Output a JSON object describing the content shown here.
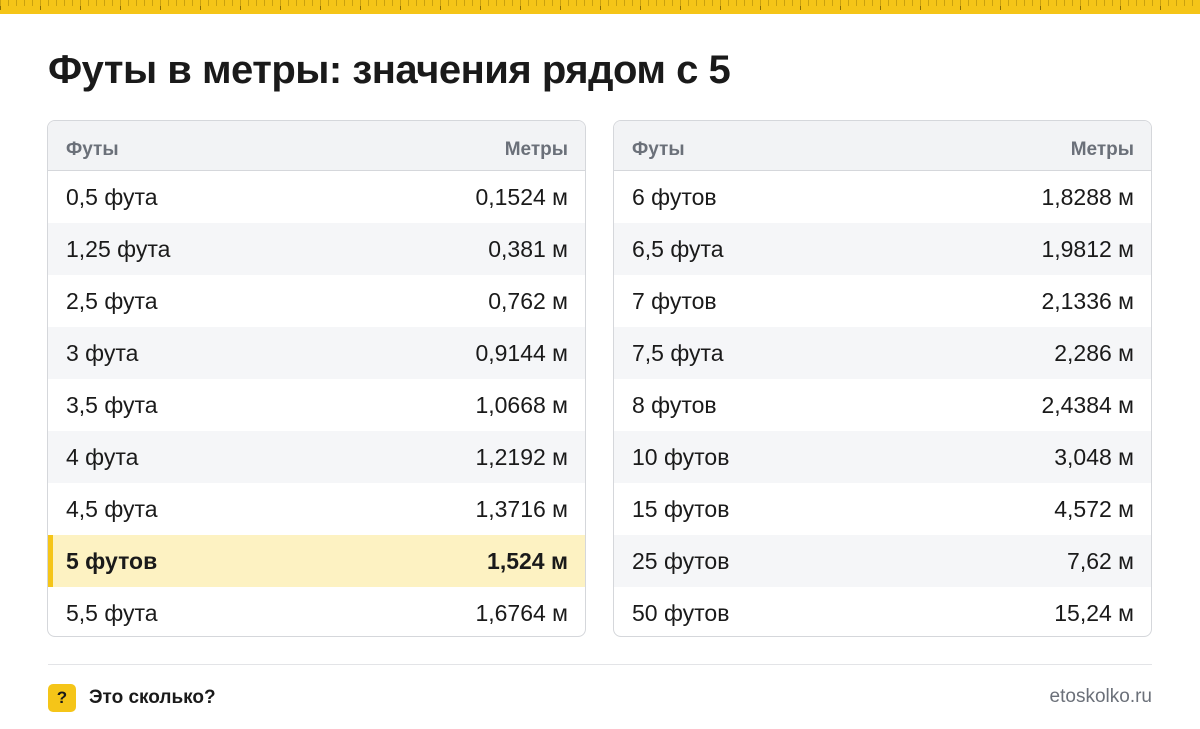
{
  "title": "Футы в метры: значения рядом с 5",
  "table_left": {
    "header": {
      "feet": "Футы",
      "meters": "Метры"
    },
    "rows": [
      {
        "feet": "0,5 фута",
        "meters": "0,1524 м"
      },
      {
        "feet": "1,25 фута",
        "meters": "0,381 м"
      },
      {
        "feet": "2,5 фута",
        "meters": "0,762 м"
      },
      {
        "feet": "3 фута",
        "meters": "0,9144 м"
      },
      {
        "feet": "3,5 фута",
        "meters": "1,0668 м"
      },
      {
        "feet": "4 фута",
        "meters": "1,2192 м"
      },
      {
        "feet": "4,5 фута",
        "meters": "1,3716 м"
      },
      {
        "feet": "5 футов",
        "meters": "1,524 м"
      },
      {
        "feet": "5,5 фута",
        "meters": "1,6764 м"
      }
    ]
  },
  "table_right": {
    "header": {
      "feet": "Футы",
      "meters": "Метры"
    },
    "rows": [
      {
        "feet": "6 футов",
        "meters": "1,8288 м"
      },
      {
        "feet": "6,5 фута",
        "meters": "1,9812 м"
      },
      {
        "feet": "7 футов",
        "meters": "2,1336 м"
      },
      {
        "feet": "7,5 фута",
        "meters": "2,286 м"
      },
      {
        "feet": "8 футов",
        "meters": "2,4384 м"
      },
      {
        "feet": "10 футов",
        "meters": "3,048 м"
      },
      {
        "feet": "15 футов",
        "meters": "4,572 м"
      },
      {
        "feet": "25 футов",
        "meters": "7,62 м"
      },
      {
        "feet": "50 футов",
        "meters": "15,24 м"
      }
    ]
  },
  "footer": {
    "icon": "question-mark-icon",
    "icon_glyph": "?",
    "brand": "Это сколько?",
    "site": "etoskolko.ru"
  },
  "colors": {
    "accent": "#f5c518",
    "highlight_row": "#fdf2c2",
    "header_bg": "#f2f3f5",
    "muted_text": "#6b7079"
  }
}
